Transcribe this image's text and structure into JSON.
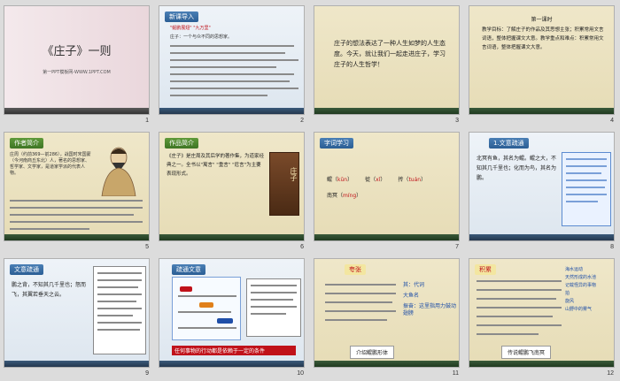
{
  "slides": [
    {
      "number": "1",
      "title": "《庄子》一则",
      "subtitle": "第一PPT模板网-WWW.1PPT.COM"
    },
    {
      "number": "2",
      "tag": "新课导入",
      "lines": [
        "\"鲲鹏展翅\" \"九万里\"",
        "庄子：一个与众不同的思想家。"
      ]
    },
    {
      "number": "3",
      "text": "庄子的想法表达了一种人生如梦的人生态度。今天，就让我们一起走进庄子，学习庄子的人生哲学！"
    },
    {
      "number": "4",
      "heading": "第一课时",
      "text": "教学目标：了解庄子的作品及其思想主张；积累常用文言词语，整体把握课文大意。教学重点和难点：积累常用文言词语，整体把握课文大意。"
    },
    {
      "number": "5",
      "tag": "作者简介",
      "text": "庄周（约前369—前286），战国时宋国蒙（今河南商丘东北）人，著名的思想家、哲学家、文学家，是道家学派的代表人物。"
    },
    {
      "number": "6",
      "tag": "作品简介",
      "text": "《庄子》是庄周及其后学的著作集，为道家经典之一。全书以\"寓言\" \"重言\" \"卮言\"为主要表现形式。",
      "book_title": "庄子"
    },
    {
      "number": "7",
      "tag": "字词学习",
      "words": [
        {
          "char": "鲲",
          "pinyin": "kūn"
        },
        {
          "char": "徙",
          "pinyin": "xǐ"
        },
        {
          "char": "抟",
          "pinyin": "tuán"
        },
        {
          "char": "南冥",
          "pinyin": "míng"
        }
      ]
    },
    {
      "number": "8",
      "tag": "1.文意疏通",
      "text": "北冥有鱼，其名为鲲。鲲之大，不知其几千里也；化而为鸟，其名为鹏。"
    },
    {
      "number": "9",
      "tag": "文意疏通",
      "text": "鹏之背，不知其几千里也；怒而飞，其翼若垂天之云。"
    },
    {
      "number": "10",
      "tag": "疏通文意",
      "footer": "任何事物的行动都是依赖于一定的条件"
    },
    {
      "number": "11",
      "tag": "夸张",
      "footer": "介绍鲲鹏形体",
      "notes": [
        "其：代词",
        "大鱼名",
        "振奋：这里指用力鼓动翅膀"
      ]
    },
    {
      "number": "12",
      "tag": "积累",
      "footer": "传说鲲鹏飞南冥",
      "terms": [
        "海水运动",
        "天然形成的水池",
        "记载怪异的事物",
        "拍",
        "旋风",
        "山野中的雾气"
      ]
    }
  ],
  "colors": {
    "red": "#c0121a",
    "blue": "#1f4fa8",
    "green": "#2c7a1e"
  }
}
